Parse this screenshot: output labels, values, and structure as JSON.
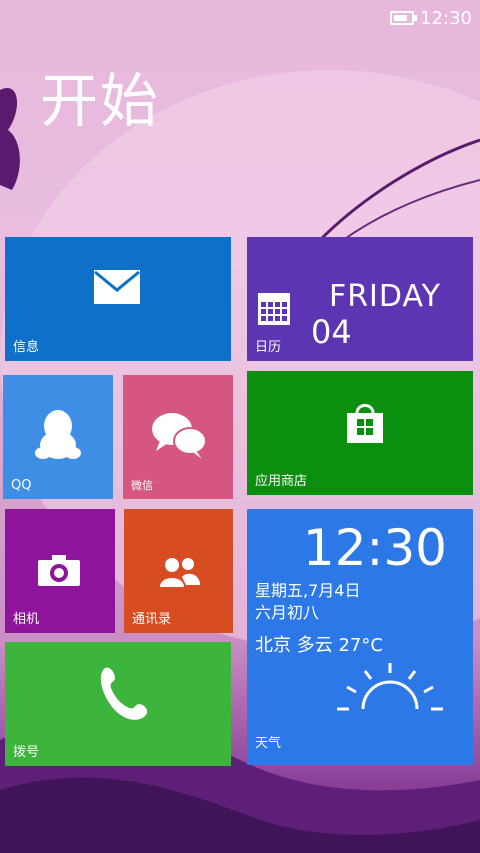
{
  "status": {
    "time": "12:30",
    "battery_level": 0.8
  },
  "page_title": "开始",
  "tiles": {
    "messages": {
      "label": "信息",
      "color": "#0e70c8"
    },
    "calendar": {
      "label": "日历",
      "day": "FRIDAY",
      "date": "04",
      "color": "#5c35b3"
    },
    "qq": {
      "label": "QQ",
      "color": "#3f8ee6"
    },
    "wechat": {
      "label": "微信",
      "color": "#d5577f"
    },
    "store": {
      "label": "应用商店",
      "color": "#0b8f0f"
    },
    "camera": {
      "label": "相机",
      "color": "#8e159b"
    },
    "contacts": {
      "label": "通讯录",
      "color": "#d74c21"
    },
    "dialer": {
      "label": "拨号",
      "color": "#3db53d"
    },
    "weather": {
      "label": "天气",
      "time": "12:30",
      "date_line": "星期五,7月4日",
      "lunar_line": "六月初八",
      "forecast_line": "北京 多云 27°C",
      "icon": "sun-icon",
      "color": "#2c78e6"
    }
  }
}
